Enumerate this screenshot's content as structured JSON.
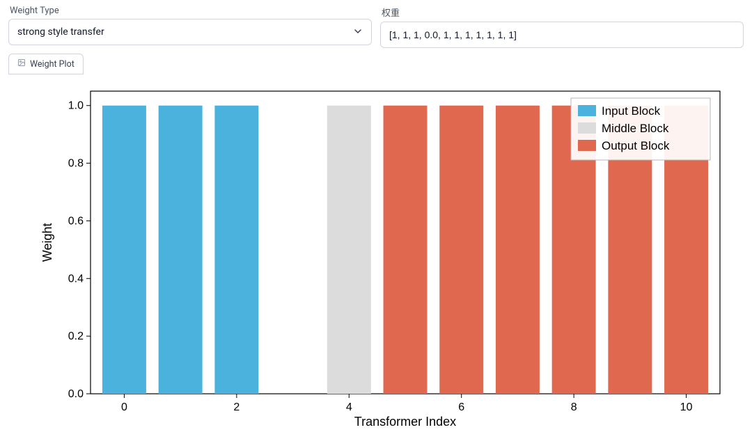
{
  "fields": {
    "weight_type": {
      "label": "Weight Type",
      "value": "strong style transfer"
    },
    "weights": {
      "label": "权重",
      "value": "[1, 1, 1, 0.0, 1, 1, 1, 1, 1, 1, 1]"
    }
  },
  "tab": {
    "label": "Weight Plot"
  },
  "chart_data": {
    "type": "bar",
    "categories": [
      0,
      1,
      2,
      3,
      4,
      5,
      6,
      7,
      8,
      9,
      10
    ],
    "series": [
      {
        "name": "Input Block",
        "indices": [
          0,
          1,
          2,
          3
        ],
        "values": [
          1,
          1,
          1,
          0.0
        ],
        "color": "#4ab2dc"
      },
      {
        "name": "Middle Block",
        "indices": [
          4
        ],
        "values": [
          1
        ],
        "color": "#dcdcdc"
      },
      {
        "name": "Output Block",
        "indices": [
          5,
          6,
          7,
          8,
          9,
          10
        ],
        "values": [
          1,
          1,
          1,
          1,
          1,
          1
        ],
        "color": "#e0684f"
      }
    ],
    "xlabel": "Transformer Index",
    "ylabel": "Weight",
    "xlim": [
      -0.6,
      10.6
    ],
    "ylim": [
      0.0,
      1.05
    ],
    "x_ticks": [
      0,
      2,
      4,
      6,
      8,
      10
    ],
    "y_ticks": [
      0.0,
      0.2,
      0.4,
      0.6,
      0.8,
      1.0
    ],
    "legend_position": "upper right"
  }
}
